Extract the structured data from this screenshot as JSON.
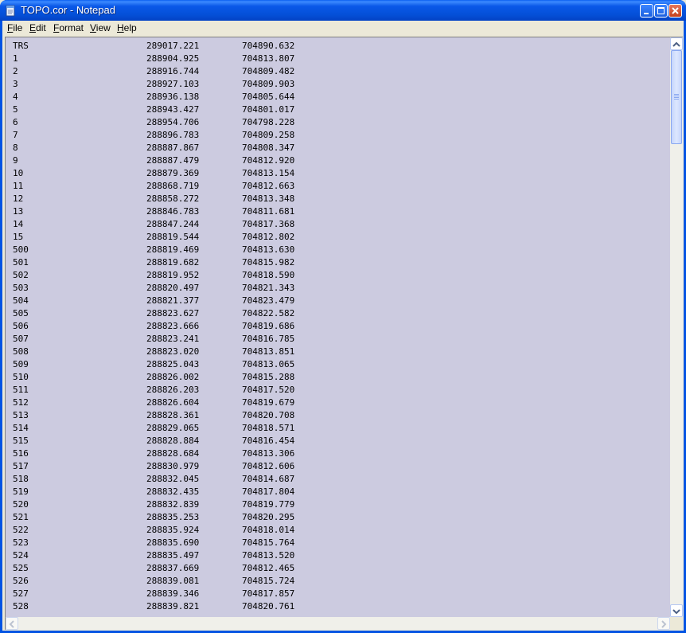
{
  "window": {
    "title": "TOPO.cor - Notepad",
    "app_icon": "notepad-icon",
    "controls": [
      "minimize-icon",
      "maximize-icon",
      "close-icon"
    ]
  },
  "menu": {
    "items": [
      {
        "label": "File",
        "accel": "F",
        "rest": "ile"
      },
      {
        "label": "Edit",
        "accel": "E",
        "rest": "dit"
      },
      {
        "label": "Format",
        "accel": "F",
        "rest": "ormat"
      },
      {
        "label": "View",
        "accel": "V",
        "rest": "iew"
      },
      {
        "label": "Help",
        "accel": "H",
        "rest": "elp"
      }
    ]
  },
  "document": {
    "rows": [
      [
        "TRS",
        "289017.221",
        "704890.632"
      ],
      [
        "1",
        "288904.925",
        "704813.807"
      ],
      [
        "2",
        "288916.744",
        "704809.482"
      ],
      [
        "3",
        "288927.103",
        "704809.903"
      ],
      [
        "4",
        "288936.138",
        "704805.644"
      ],
      [
        "5",
        "288943.427",
        "704801.017"
      ],
      [
        "6",
        "288954.706",
        "704798.228"
      ],
      [
        "7",
        "288896.783",
        "704809.258"
      ],
      [
        "8",
        "288887.867",
        "704808.347"
      ],
      [
        "9",
        "288887.479",
        "704812.920"
      ],
      [
        "10",
        "288879.369",
        "704813.154"
      ],
      [
        "11",
        "288868.719",
        "704812.663"
      ],
      [
        "12",
        "288858.272",
        "704813.348"
      ],
      [
        "13",
        "288846.783",
        "704811.681"
      ],
      [
        "14",
        "288847.244",
        "704817.368"
      ],
      [
        "15",
        "288819.544",
        "704812.802"
      ],
      [
        "500",
        "288819.469",
        "704813.630"
      ],
      [
        "501",
        "288819.682",
        "704815.982"
      ],
      [
        "502",
        "288819.952",
        "704818.590"
      ],
      [
        "503",
        "288820.497",
        "704821.343"
      ],
      [
        "504",
        "288821.377",
        "704823.479"
      ],
      [
        "505",
        "288823.627",
        "704822.582"
      ],
      [
        "506",
        "288823.666",
        "704819.686"
      ],
      [
        "507",
        "288823.241",
        "704816.785"
      ],
      [
        "508",
        "288823.020",
        "704813.851"
      ],
      [
        "509",
        "288825.043",
        "704813.065"
      ],
      [
        "510",
        "288826.002",
        "704815.288"
      ],
      [
        "511",
        "288826.203",
        "704817.520"
      ],
      [
        "512",
        "288826.604",
        "704819.679"
      ],
      [
        "513",
        "288828.361",
        "704820.708"
      ],
      [
        "514",
        "288829.065",
        "704818.571"
      ],
      [
        "515",
        "288828.884",
        "704816.454"
      ],
      [
        "516",
        "288828.684",
        "704813.306"
      ],
      [
        "517",
        "288830.979",
        "704812.606"
      ],
      [
        "518",
        "288832.045",
        "704814.687"
      ],
      [
        "519",
        "288832.435",
        "704817.804"
      ],
      [
        "520",
        "288832.839",
        "704819.779"
      ],
      [
        "521",
        "288835.253",
        "704820.295"
      ],
      [
        "522",
        "288835.924",
        "704818.014"
      ],
      [
        "523",
        "288835.690",
        "704815.764"
      ],
      [
        "524",
        "288835.497",
        "704813.520"
      ],
      [
        "525",
        "288837.669",
        "704812.465"
      ],
      [
        "526",
        "288839.081",
        "704815.724"
      ],
      [
        "527",
        "288839.346",
        "704817.857"
      ],
      [
        "528",
        "288839.821",
        "704820.761"
      ]
    ]
  },
  "colors": {
    "text_background": "#cccbe0",
    "titlebar": "#0450d8"
  },
  "scrollbars": {
    "vertical": [
      "scroll-up-arrow-icon",
      "scroll-down-arrow-icon"
    ],
    "horizontal": [
      "scroll-left-arrow-icon",
      "scroll-right-arrow-icon"
    ]
  }
}
